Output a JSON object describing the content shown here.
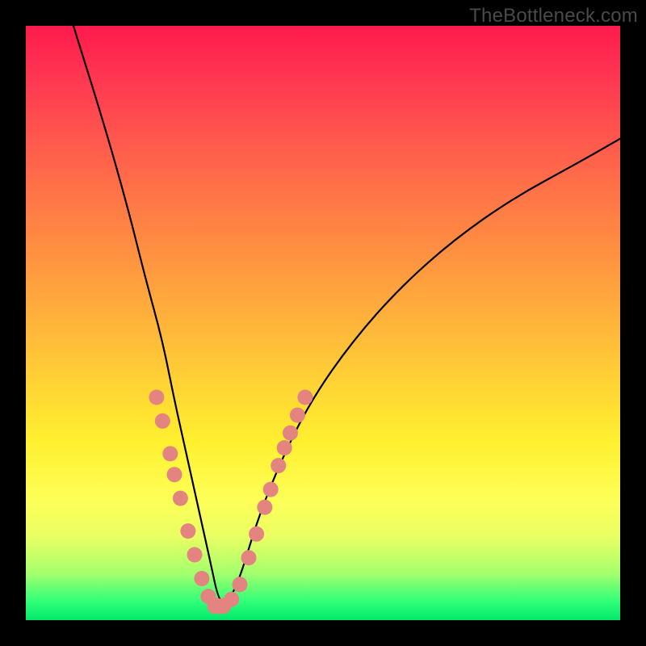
{
  "watermark": "TheBottleneck.com",
  "chart_data": {
    "type": "line",
    "title": "",
    "xlabel": "",
    "ylabel": "",
    "xlim": [
      0,
      100
    ],
    "ylim": [
      0,
      100
    ],
    "grid": false,
    "legend": false,
    "note": "Values approximate; chart has no visible numeric axes or tick labels. x is normalized horizontal position (0–100 left→right), y is normalized vertical position (0–100, 0 = bottom/green, 100 = top/red). Curve forms an asymmetric V with minimum near x≈32.",
    "series": [
      {
        "name": "bottleneck-curve",
        "x": [
          8,
          13,
          17,
          20,
          23,
          25,
          27,
          29,
          31,
          32.5,
          34,
          36,
          39,
          43,
          48,
          55,
          63,
          72,
          82,
          93,
          100
        ],
        "y": [
          100,
          84,
          70,
          58,
          47,
          37,
          28,
          19,
          10,
          3,
          3,
          7,
          17,
          27,
          37,
          47,
          56,
          64,
          71,
          77,
          81
        ]
      }
    ],
    "markers": {
      "name": "highlighted-points",
      "color": "#e38481",
      "note": "Pink bead markers clustered near the trough on both branches.",
      "points": [
        {
          "x": 22.0,
          "y": 37.5
        },
        {
          "x": 23.0,
          "y": 33.5
        },
        {
          "x": 24.3,
          "y": 28.0
        },
        {
          "x": 25.0,
          "y": 24.5
        },
        {
          "x": 26.0,
          "y": 20.5
        },
        {
          "x": 27.3,
          "y": 15.0
        },
        {
          "x": 28.4,
          "y": 11.0
        },
        {
          "x": 29.6,
          "y": 7.0
        },
        {
          "x": 30.7,
          "y": 4.0
        },
        {
          "x": 32.0,
          "y": 2.5
        },
        {
          "x": 33.3,
          "y": 2.5
        },
        {
          "x": 34.6,
          "y": 3.5
        },
        {
          "x": 36.0,
          "y": 6.0
        },
        {
          "x": 37.5,
          "y": 10.5
        },
        {
          "x": 38.8,
          "y": 14.5
        },
        {
          "x": 40.2,
          "y": 19.0
        },
        {
          "x": 41.2,
          "y": 22.0
        },
        {
          "x": 42.5,
          "y": 26.0
        },
        {
          "x": 43.5,
          "y": 29.0
        },
        {
          "x": 44.5,
          "y": 31.5
        },
        {
          "x": 45.7,
          "y": 34.5
        },
        {
          "x": 47.0,
          "y": 37.5
        }
      ]
    },
    "flat_segment": {
      "name": "trough-flat",
      "color": "#e38481",
      "x_start": 30.5,
      "x_end": 34.5,
      "y": 2.3
    }
  }
}
